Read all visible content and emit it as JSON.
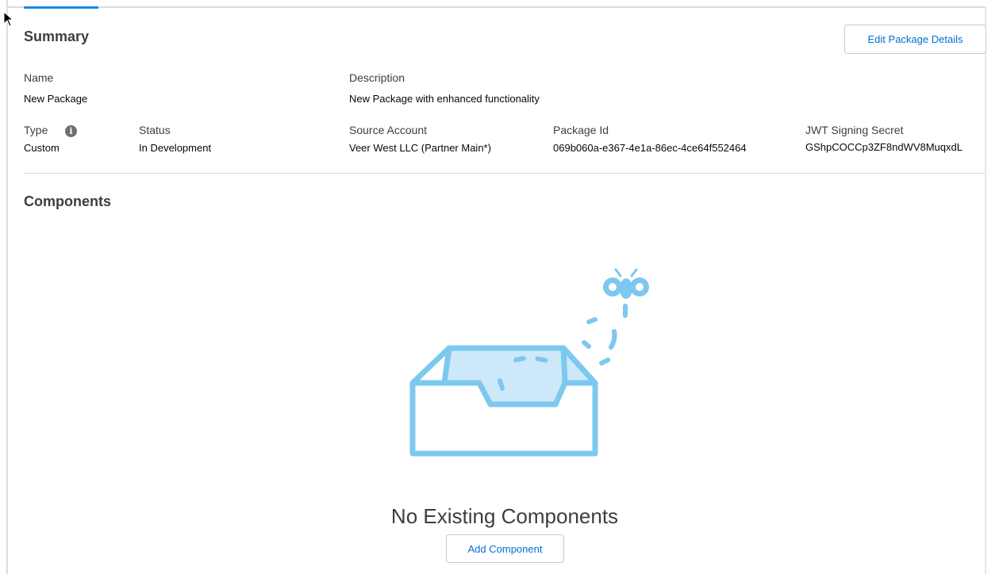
{
  "summary": {
    "title": "Summary",
    "edit_button_label": "Edit Package Details",
    "fields": {
      "name": {
        "label": "Name",
        "value": "New Package"
      },
      "description": {
        "label": "Description",
        "value": "New Package with enhanced functionality"
      },
      "type": {
        "label": "Type",
        "value": "Custom",
        "info_icon": "info-icon"
      },
      "status": {
        "label": "Status",
        "value": "In Development"
      },
      "source_account": {
        "label": "Source Account",
        "value": "Veer West LLC (Partner Main*)"
      },
      "package_id": {
        "label": "Package Id",
        "value": "069b060a-e367-4e1a-86ec-4ce64f552464"
      },
      "jwt_secret": {
        "label": "JWT Signing Secret",
        "value": "GShpCOCCp3ZF8ndWV8MuqxdL"
      }
    }
  },
  "components": {
    "title": "Components",
    "empty_state": {
      "message": "No Existing Components",
      "illustration_icon": "open-box-with-bug-icon",
      "add_button_label": "Add Component"
    }
  },
  "colors": {
    "accent": "#1589ee",
    "link": "#0070d2",
    "illustration_stroke": "#7cc8ef",
    "illustration_fill": "#cde9f9"
  }
}
